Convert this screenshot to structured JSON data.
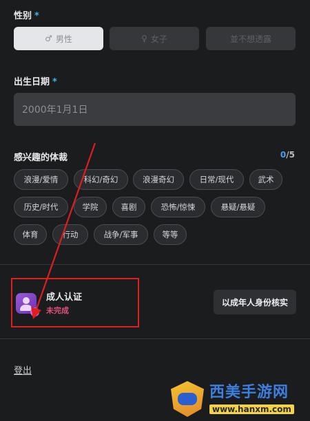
{
  "gender": {
    "label": "性别",
    "required_mark": "*",
    "options": [
      {
        "label": "男性",
        "icon": "male-icon",
        "selected": true
      },
      {
        "label": "女子",
        "icon": "female-icon",
        "selected": false
      },
      {
        "label": "並不想透露",
        "selected": false
      }
    ]
  },
  "birth": {
    "label": "出生日期",
    "required_mark": "*",
    "value": "2000年1月1日"
  },
  "genres": {
    "label": "感兴趣的体裁",
    "selected_count": "0",
    "max_count": "/5",
    "tags": [
      "浪漫/爱情",
      "科幻/奇幻",
      "浪漫奇幻",
      "日常/现代",
      "武术",
      "历史/时代",
      "学院",
      "喜剧",
      "恐怖/惊悚",
      "悬疑/悬疑",
      "体育",
      "行动",
      "战争/军事",
      "等等"
    ]
  },
  "verification": {
    "title": "成人认证",
    "status": "未完成",
    "status_color": "#e0527a",
    "button_label": "以成年人身份核实",
    "avatar_icon": "user-verify-icon"
  },
  "logout_label": "登出",
  "watermark": {
    "title": "西美手游网",
    "url": "www.hanxm.com"
  },
  "colors": {
    "accent": "#3fb5e8",
    "counter": "#4a9ef0",
    "annotation": "#e01e1e"
  }
}
